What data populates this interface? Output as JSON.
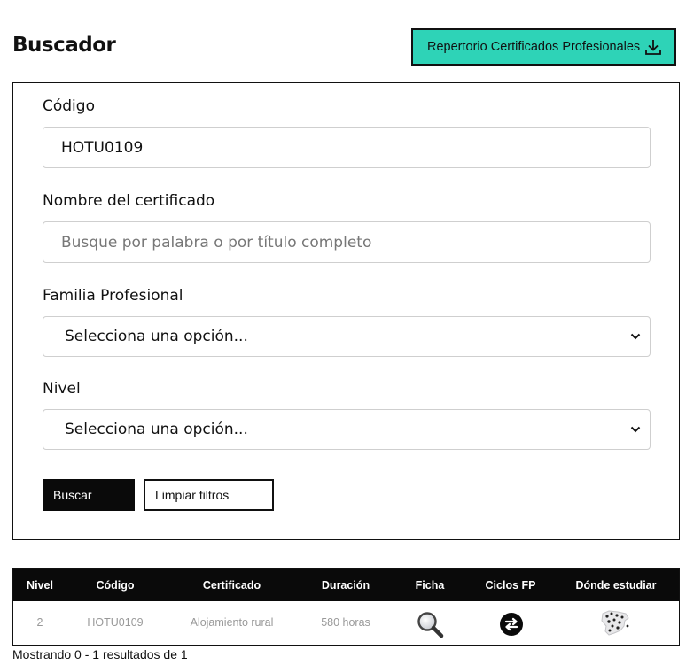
{
  "header": {
    "title": "Buscador",
    "download_label": "Repertorio Certificados Profesionales"
  },
  "form": {
    "codigo": {
      "label": "Código",
      "value": "HOTU0109"
    },
    "nombre": {
      "label": "Nombre del certificado",
      "placeholder": "Busque por palabra o por título completo"
    },
    "familia": {
      "label": "Familia Profesional",
      "selected": "Selecciona una opción..."
    },
    "nivel": {
      "label": "Nivel",
      "selected": "Selecciona una opción..."
    },
    "search_label": "Buscar",
    "clear_label": "Limpiar filtros"
  },
  "results": {
    "columns": [
      "Nivel",
      "Código",
      "Certificado",
      "Duración",
      "Ficha",
      "Ciclos FP",
      "Dónde estudiar"
    ],
    "rows": [
      {
        "nivel": "2",
        "codigo": "HOTU0109",
        "certificado": "Alojamiento rural",
        "duracion": "580 horas"
      }
    ],
    "summary": "Mostrando 0 - 1 resultados de 1"
  },
  "colors": {
    "accent": "#2ed3b7",
    "dark": "#0a0a0a"
  },
  "icons": {
    "download": "download-icon",
    "ficha": "magnifier-icon",
    "ciclos": "swap-arrows-icon",
    "donde": "spain-map-icon",
    "select": "chevron-down-icon"
  }
}
